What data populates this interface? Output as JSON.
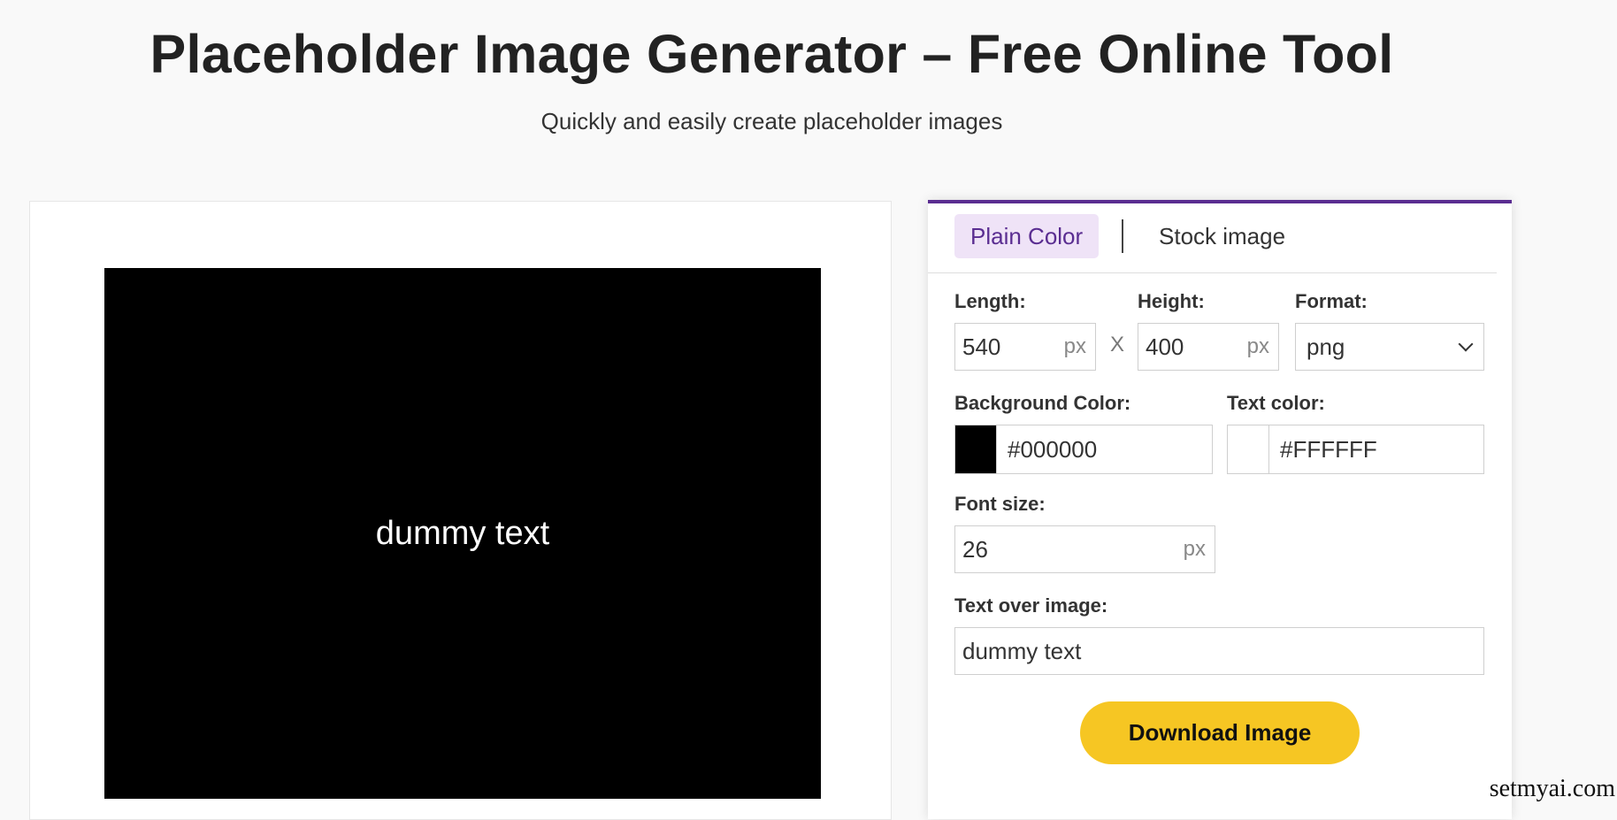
{
  "header": {
    "title": "Placeholder Image Generator – Free Online Tool",
    "subtitle": "Quickly and easily create placeholder images"
  },
  "preview": {
    "background_color": "#000000",
    "text_color": "#FFFFFF",
    "text": "dummy text"
  },
  "tabs": [
    {
      "label": "Plain Color",
      "active": true
    },
    {
      "label": "Stock image",
      "active": false
    }
  ],
  "form": {
    "length": {
      "label": "Length:",
      "value": "540",
      "unit": "px"
    },
    "times_sign": "X",
    "height": {
      "label": "Height:",
      "value": "400",
      "unit": "px"
    },
    "format": {
      "label": "Format:",
      "value": "png"
    },
    "background_color": {
      "label": "Background Color:",
      "value": "#000000",
      "swatch": "#000000"
    },
    "text_color": {
      "label": "Text color:",
      "value": "#FFFFFF",
      "swatch": "#FFFFFF"
    },
    "font_size": {
      "label": "Font size:",
      "value": "26",
      "unit": "px"
    },
    "text_over_image": {
      "label": "Text over image:",
      "value": "dummy text"
    }
  },
  "download_button": {
    "label": "Download Image",
    "color": "#f6c623"
  },
  "accent_color": "#5a2d91",
  "watermark": "setmyai.com"
}
